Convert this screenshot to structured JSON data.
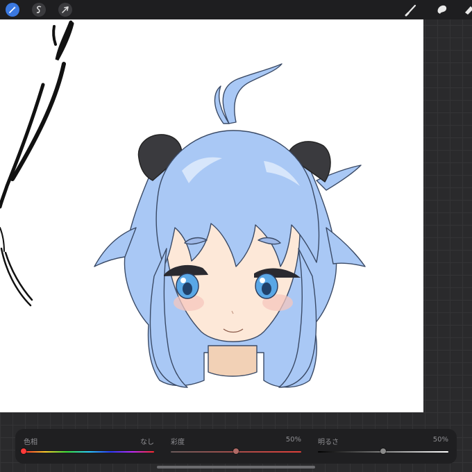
{
  "toolbar": {
    "left_tools": [
      {
        "icon": "magic-wand-icon",
        "active": true
      },
      {
        "icon": "selection-s-icon",
        "active": false
      },
      {
        "icon": "move-arrow-icon",
        "active": false
      }
    ],
    "right_tools": [
      "brush-icon",
      "smudge-icon",
      "eraser-icon"
    ],
    "accent_color": "#3a78e0"
  },
  "canvas": {
    "background": "#ffffff",
    "subject": "anime-girl-head",
    "hair_color": "#a9c8f5",
    "skin_color": "#fde8d8",
    "ear_color": "#3a3a3e"
  },
  "adjustments": {
    "hue": {
      "label": "色相",
      "value": "なし",
      "level": 0.0
    },
    "saturation": {
      "label": "彩度",
      "value": "50%",
      "level": 0.5
    },
    "brightness": {
      "label": "明るさ",
      "value": "50%",
      "level": 0.5
    }
  }
}
